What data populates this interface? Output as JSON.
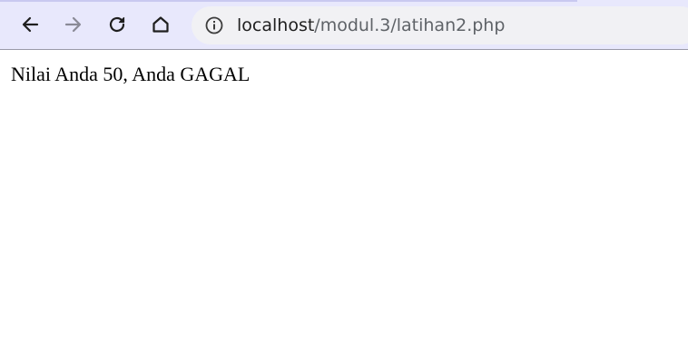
{
  "browser": {
    "url_host": "localhost",
    "url_path": "/modul.3/latihan2.php",
    "icons": {
      "back": "arrow-left-icon",
      "forward": "arrow-right-icon",
      "reload": "reload-icon",
      "home": "home-icon",
      "site_info": "info-circle-icon"
    },
    "colors": {
      "toolbar_bg": "#e8e8fc",
      "omnibox_bg": "#f1f1f4",
      "icon_active": "#1f1f1f",
      "icon_disabled": "#8a8a96"
    }
  },
  "page": {
    "message": "Nilai Anda 50, Anda GAGAL"
  }
}
